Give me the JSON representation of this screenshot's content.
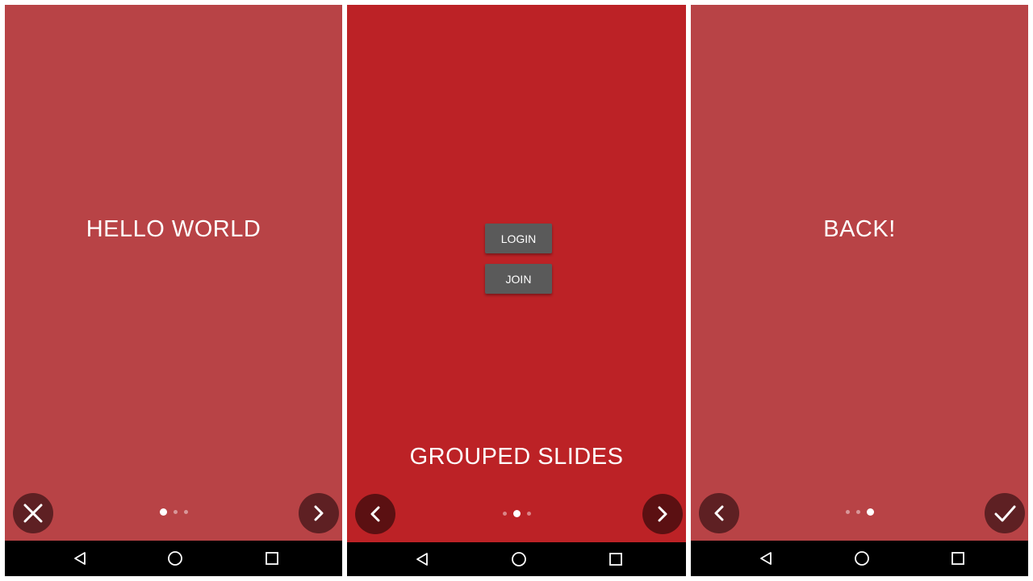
{
  "colors": {
    "slide_muted": "#b84346",
    "slide_active": "#bc2226",
    "fab_bg": "#5e2023",
    "fab_bg_active": "#5b1012",
    "button_bg": "#5a5a5a",
    "navbar": "#000000"
  },
  "screens": [
    {
      "headline": "HELLO WORLD",
      "left_control": {
        "icon": "close-icon"
      },
      "right_control": {
        "icon": "chevron-right-icon"
      },
      "page_indicator": {
        "active_index": 0,
        "count": 3
      }
    },
    {
      "headline": "GROUPED SLIDES",
      "buttons": [
        "LOGIN",
        "JOIN"
      ],
      "left_control": {
        "icon": "chevron-left-icon"
      },
      "right_control": {
        "icon": "chevron-right-icon"
      },
      "page_indicator": {
        "active_index": 1,
        "count": 3
      }
    },
    {
      "headline": "BACK!",
      "left_control": {
        "icon": "chevron-left-icon"
      },
      "right_control": {
        "icon": "check-icon"
      },
      "page_indicator": {
        "active_index": 2,
        "count": 3
      }
    }
  ],
  "navbar_icons": [
    "back-triangle-icon",
    "home-circle-icon",
    "recents-square-icon"
  ]
}
